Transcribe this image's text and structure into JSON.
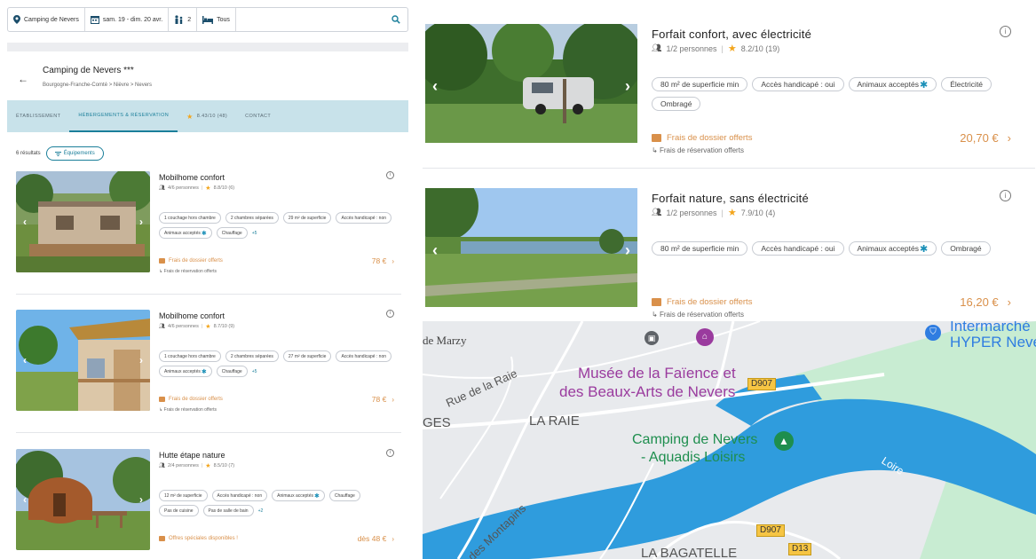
{
  "search": {
    "location": "Camping de Nevers",
    "dates": "sam. 19 - dim. 20 avr.",
    "guests": "2",
    "type": "Tous"
  },
  "header": {
    "title": "Camping de Nevers ***",
    "breadcrumb": "Bourgogne-Franche-Comté  >  Nièvre  >  Nevers"
  },
  "tabs": {
    "etablissement": "ÉTABLISSEMENT",
    "hebergements": "HÉBERGEMENTS & RÉSERVATION",
    "rating": "8.43/10 (48)",
    "contact": "CONTACT"
  },
  "results": {
    "count": "6 résultats",
    "filter_label": "Équipements"
  },
  "left_cards": [
    {
      "title": "Mobilhome confort",
      "persons": "4/6 personnes",
      "rating": "8.8/10 (6)",
      "chips": [
        "1 couchage hors chambre",
        "2 chambres séparées",
        "29 m² de superficie",
        "Accès handicapé : non",
        "Animaux acceptés",
        "Chauffage"
      ],
      "more": "+5",
      "offer": "Frais de dossier offerts",
      "resa": "Frais de réservation offerts",
      "price": "78 €"
    },
    {
      "title": "Mobilhome confort",
      "persons": "4/6 personnes",
      "rating": "8.7/10 (9)",
      "chips": [
        "1 couchage hors chambre",
        "2 chambres séparées",
        "27 m² de superficie",
        "Accès handicapé : non",
        "Animaux acceptés",
        "Chauffage"
      ],
      "more": "+5",
      "offer": "Frais de dossier offerts",
      "resa": "Frais de réservation offerts",
      "price": "78 €"
    },
    {
      "title": "Hutte étape nature",
      "persons": "2/4 personnes",
      "rating": "8.5/10 (7)",
      "chips": [
        "12 m² de superficie",
        "Accès handicapé : non",
        "Animaux acceptés",
        "Chauffage",
        "Pas de cuisine",
        "Pas de salle de bain"
      ],
      "more": "+2",
      "offer": "Offres spéciales disponibles !",
      "resa": "",
      "price": "dès 48 €"
    }
  ],
  "right_cards": [
    {
      "title": "Forfait confort, avec électricité",
      "persons": "1/2 personnes",
      "rating": "8.2/10 (19)",
      "chips": [
        "80 m² de superficie min",
        "Accès handicapé : oui",
        "Animaux acceptés",
        "Électricité",
        "Ombragé"
      ],
      "offer": "Frais de dossier offerts",
      "resa": "Frais de réservation offerts",
      "price": "20,70 €"
    },
    {
      "title": "Forfait nature, sans électricité",
      "persons": "1/2 personnes",
      "rating": "7.9/10 (4)",
      "chips": [
        "80 m² de superficie min",
        "Accès handicapé : oui",
        "Animaux acceptés",
        "Ombragé"
      ],
      "offer": "Frais de dossier offerts",
      "resa": "Frais de réservation offerts",
      "price": "16,20 €"
    }
  ],
  "map": {
    "labels": {
      "marzy": "de Marzy",
      "musee_1": "Musée de la Faïence et",
      "musee_2": "des Beaux-Arts de Nevers",
      "rue_raie": "Rue de la Raie",
      "ges": "GES",
      "la_raie": "LA RAIE",
      "camping_1": "Camping de Nevers",
      "camping_2": "- Aquadis Loisirs",
      "loire": "Loire",
      "montapins": "des Montapins",
      "bagatelle": "LA BAGATELLE",
      "intermarche_1": "Intermarché",
      "intermarche_2": "HYPER Neve",
      "d907a": "D907",
      "d907b": "D907",
      "d13": "D13"
    },
    "colors": {
      "water": "#2f9cdd",
      "land": "#e8eaed",
      "park": "#c8ecd2",
      "poi": "#9a3b9e",
      "camping_pin": "#1e8e4e"
    }
  },
  "colors": {
    "accent": "#1b7f9a",
    "price": "#d9904a",
    "star": "#f3a51c",
    "paw": "#1a8fb7"
  }
}
